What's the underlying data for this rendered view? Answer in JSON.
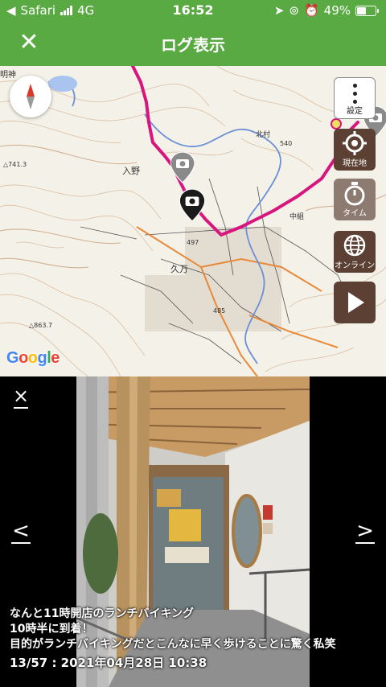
{
  "status_bar": {
    "carrier": "Safari",
    "network": "4G",
    "time": "16:52",
    "battery": "49%",
    "battery_level": 0.49
  },
  "header": {
    "title": "ログ表示",
    "close_icon": "close-icon"
  },
  "map": {
    "attribution": "Google",
    "place_labels": [
      "明神",
      "入野",
      "久万",
      "北村",
      "中組"
    ],
    "elevation_labels": [
      "△741.3",
      "△863.7",
      "497",
      "485",
      "540"
    ],
    "controls": [
      {
        "id": "settings",
        "label": "設定",
        "icon": "more-vert-icon"
      },
      {
        "id": "current-location",
        "label": "現在地",
        "icon": "crosshair-icon"
      },
      {
        "id": "timer",
        "label": "タイム",
        "icon": "stopwatch-icon"
      },
      {
        "id": "online",
        "label": "オンライン",
        "icon": "globe-icon"
      },
      {
        "id": "play",
        "label": "",
        "icon": "play-icon"
      }
    ],
    "colors": {
      "route": "#d8157f",
      "accent": "#5aaa43",
      "button": "#5b4033"
    }
  },
  "viewer": {
    "caption_lines": [
      "なんと11時開店のランチバイキング",
      "10時半に到着！",
      "目的がランチバイキングだとこんなに早く歩けることに驚く私笑"
    ],
    "counter": "13/57 : 2021年04月28日 10:38",
    "prev_label": "<",
    "next_label": ">",
    "close_label": "×"
  }
}
